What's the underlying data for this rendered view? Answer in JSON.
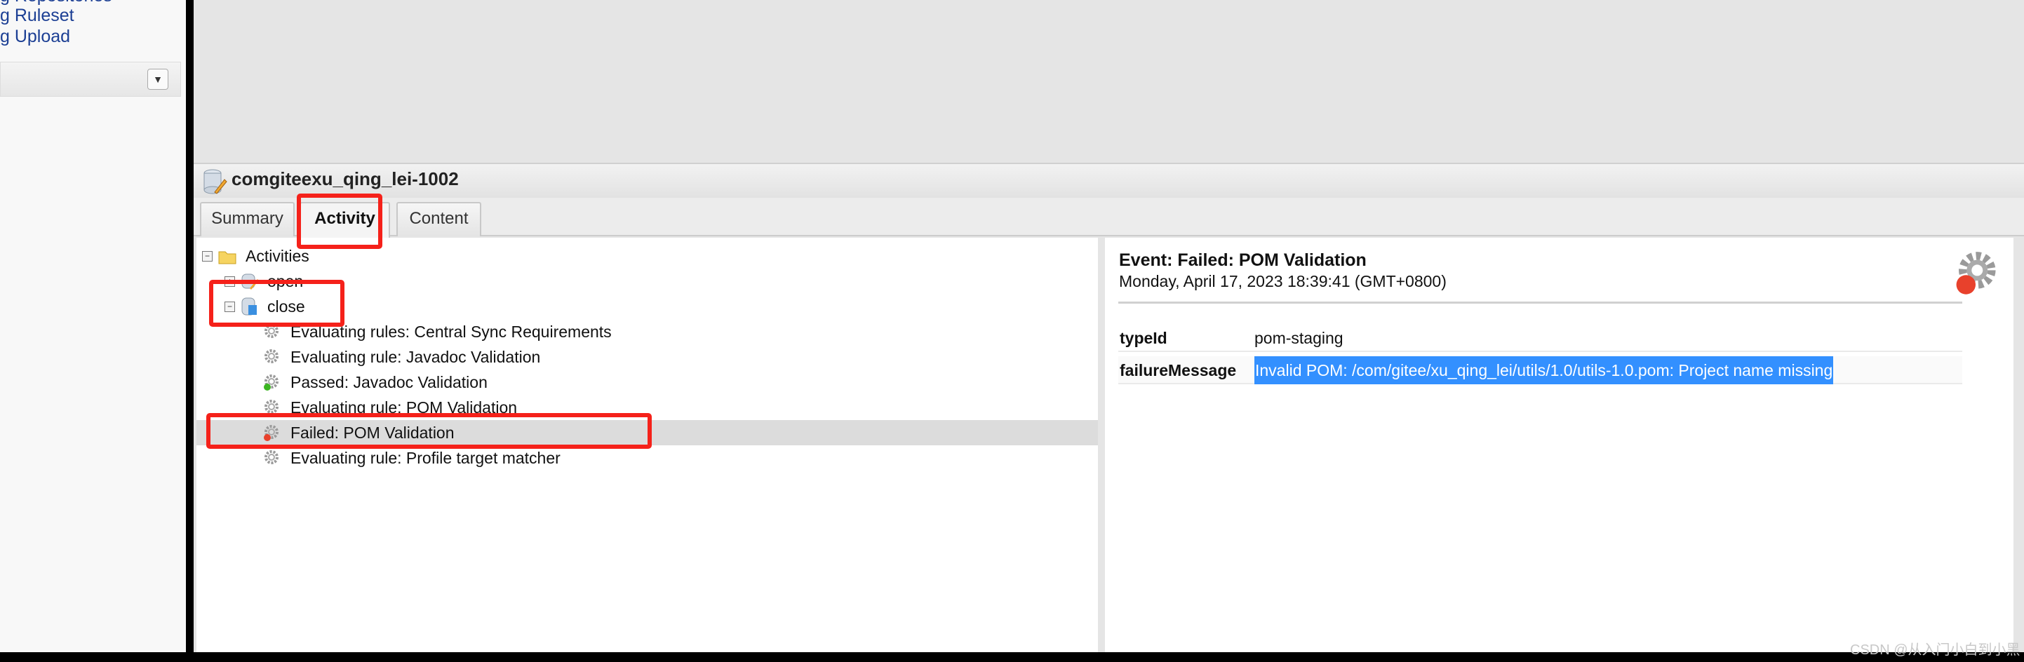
{
  "sidebar": {
    "links": [
      "g Repositories",
      "g Ruleset",
      "g Upload"
    ],
    "dropdown_icon": "triangle-down-icon"
  },
  "panel": {
    "title": "comgiteexu_qing_lei-1002",
    "icon": "repository-edit-icon"
  },
  "tabs": [
    {
      "label": "Summary",
      "active": false
    },
    {
      "label": "Activity",
      "active": true
    },
    {
      "label": "Content",
      "active": false
    }
  ],
  "tree": {
    "root": "Activities",
    "groups": [
      {
        "label": "open",
        "expanded": false
      },
      {
        "label": "close",
        "expanded": true
      }
    ],
    "events": [
      {
        "label": "Evaluating rules: Central Sync Requirements",
        "status": "info"
      },
      {
        "label": "Evaluating rule: Javadoc Validation",
        "status": "info"
      },
      {
        "label": "Passed: Javadoc Validation",
        "status": "passed"
      },
      {
        "label": "Evaluating rule: POM Validation",
        "status": "info"
      },
      {
        "label": "Failed: POM Validation",
        "status": "failed",
        "selected": true
      },
      {
        "label": "Evaluating rule: Profile target matcher",
        "status": "info"
      }
    ]
  },
  "detail": {
    "title": "Event: Failed: POM Validation",
    "date": "Monday, April 17, 2023 18:39:41 (GMT+0800)",
    "properties": [
      {
        "key": "typeId",
        "value": "pom-staging"
      },
      {
        "key": "failureMessage",
        "value": "Invalid POM: /com/gitee/xu_qing_lei/utils/1.0/utils-1.0.pom: Project name missing",
        "highlighted": true
      }
    ]
  },
  "colors": {
    "annotation": "#f5211a",
    "selection": "#3390ff",
    "passed": "#3cb521",
    "failed": "#e8412c"
  },
  "watermark": "CSDN @从入门小白到小黑"
}
